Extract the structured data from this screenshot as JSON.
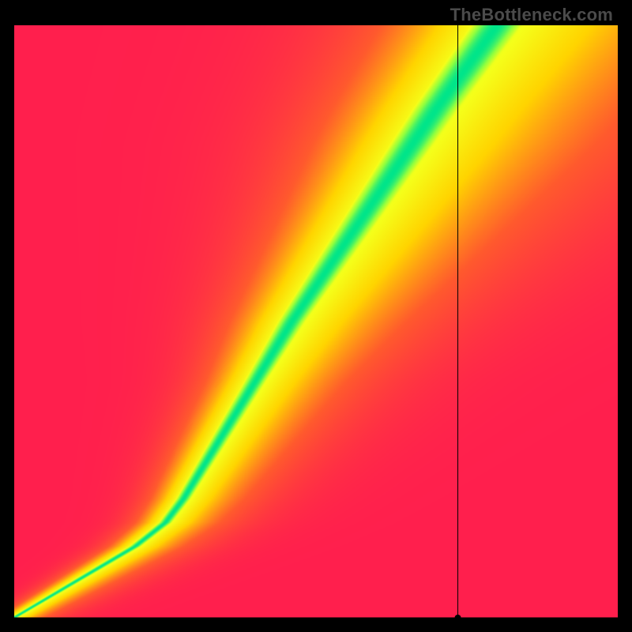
{
  "watermark": "TheBottleneck.com",
  "chart_data": {
    "type": "heatmap",
    "title": "",
    "xlabel": "",
    "ylabel": "",
    "xlim": [
      0,
      100
    ],
    "ylim": [
      0,
      100
    ],
    "value_range": [
      0,
      1
    ],
    "legend": [],
    "colormap": "red-yellow-green",
    "colormap_stops": [
      {
        "t": 0.0,
        "color": "#ff1f4d"
      },
      {
        "t": 0.25,
        "color": "#ff5a2d"
      },
      {
        "t": 0.5,
        "color": "#ffd400"
      },
      {
        "t": 0.7,
        "color": "#f5ff1a"
      },
      {
        "t": 0.85,
        "color": "#8fff40"
      },
      {
        "t": 1.0,
        "color": "#00e58a"
      }
    ],
    "ridge": {
      "description": "approximate centerline of the green optimal band (x,y) in axis units 0..100",
      "points": [
        [
          0,
          0
        ],
        [
          5,
          3
        ],
        [
          10,
          6
        ],
        [
          15,
          9
        ],
        [
          20,
          12
        ],
        [
          25,
          16
        ],
        [
          28,
          20
        ],
        [
          31,
          25
        ],
        [
          34,
          30
        ],
        [
          37,
          35
        ],
        [
          40,
          40
        ],
        [
          43,
          45
        ],
        [
          46,
          50
        ],
        [
          50,
          56
        ],
        [
          54,
          62
        ],
        [
          58,
          68
        ],
        [
          62,
          74
        ],
        [
          66,
          80
        ],
        [
          70,
          86
        ],
        [
          75,
          93
        ],
        [
          80,
          100
        ]
      ],
      "half_width_at_y": [
        [
          0,
          1.0
        ],
        [
          10,
          1.5
        ],
        [
          20,
          2.0
        ],
        [
          40,
          3.0
        ],
        [
          60,
          4.5
        ],
        [
          80,
          6.0
        ],
        [
          100,
          7.0
        ]
      ]
    },
    "crosshair": {
      "x": 73.5,
      "y": 0
    },
    "crosshair_marker_radius": 4,
    "background_gradient": {
      "description": "broad diagonal warm field, red at off-ridge corners shading to yellow/orange near ridge"
    }
  }
}
